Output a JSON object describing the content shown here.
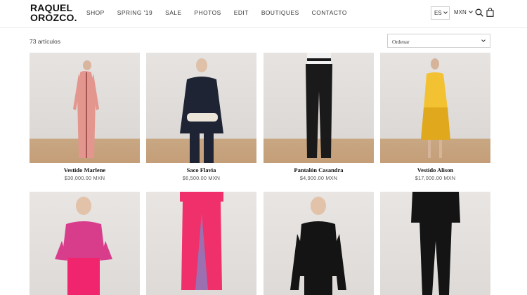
{
  "header": {
    "logo_line1": "RAQUEL",
    "logo_line2": "OROZCO.",
    "nav": [
      "SHOP",
      "SPRING '19",
      "SALE",
      "PHOTOS",
      "EDIT",
      "BOUTIQUES",
      "CONTACTO"
    ],
    "language": "ES",
    "currency": "MXN",
    "icons": [
      "search-icon",
      "shopping-bag-icon"
    ]
  },
  "listing": {
    "count_text": "73 artículos",
    "sort_label": "Ordenar"
  },
  "products": [
    {
      "name": "Vestido Marlene",
      "price": "$30,000.00 MXN",
      "colors": {
        "garment": "#e3968e",
        "trim": "#7a2a2a"
      }
    },
    {
      "name": "Saco Flavia",
      "price": "$6,500.00 MXN",
      "colors": {
        "garment": "#1e2433",
        "trim": "#ece6da"
      }
    },
    {
      "name": "Pantalón Casandra",
      "price": "$4,900.00 MXN",
      "colors": {
        "garment": "#1a1a1a",
        "trim": "#f2f2f2"
      }
    },
    {
      "name": "Vestido Alison",
      "price": "$17,000.00 MXN",
      "colors": {
        "garment": "#f2c233",
        "trim": "#e0a81c"
      }
    },
    {
      "name": "",
      "price": "",
      "colors": {
        "garment": "#d83d8c",
        "trim": "#f0256e"
      }
    },
    {
      "name": "",
      "price": "",
      "colors": {
        "garment": "#f0306a",
        "trim": "#9c6fb0"
      }
    },
    {
      "name": "",
      "price": "",
      "colors": {
        "garment": "#141414",
        "trim": "#141414"
      }
    },
    {
      "name": "",
      "price": "",
      "colors": {
        "garment": "#141414",
        "trim": "#141414"
      }
    }
  ]
}
